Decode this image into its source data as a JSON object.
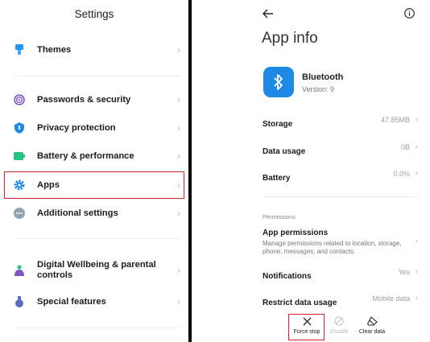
{
  "settings": {
    "title": "Settings",
    "items": [
      {
        "label": "Themes",
        "icon": "paintbrush-icon"
      },
      {
        "label": "Passwords & security",
        "icon": "fingerprint-icon"
      },
      {
        "label": "Privacy protection",
        "icon": "privacy-shield-icon"
      },
      {
        "label": "Battery & performance",
        "icon": "battery-icon"
      },
      {
        "label": "Apps",
        "icon": "gear-icon"
      },
      {
        "label": "Additional settings",
        "icon": "more-dots-icon"
      },
      {
        "label": "Digital Wellbeing & parental controls",
        "icon": "wellbeing-icon"
      },
      {
        "label": "Special features",
        "icon": "potion-icon"
      }
    ]
  },
  "app_info": {
    "title": "App info",
    "app_name": "Bluetooth",
    "version": "Version: 9",
    "storage": {
      "label": "Storage",
      "value": "47.85MB"
    },
    "data_usage": {
      "label": "Data usage",
      "value": "0B"
    },
    "battery": {
      "label": "Battery",
      "value": "0.0%"
    },
    "permissions_section": "Permissions",
    "app_permissions": {
      "label": "App permissions",
      "desc": "Manage permissions related to location, storage, phone, messages, and contacts."
    },
    "notifications": {
      "label": "Notifications",
      "value": "Yes"
    },
    "restrict_data": {
      "label": "Restrict data usage",
      "value": "Mobile data"
    },
    "actions": {
      "force_stop": "Force stop",
      "disable": "Disable",
      "clear_data": "Clear data"
    }
  },
  "colors": {
    "highlight": "#d0252c",
    "accent": "#1e88e5"
  }
}
